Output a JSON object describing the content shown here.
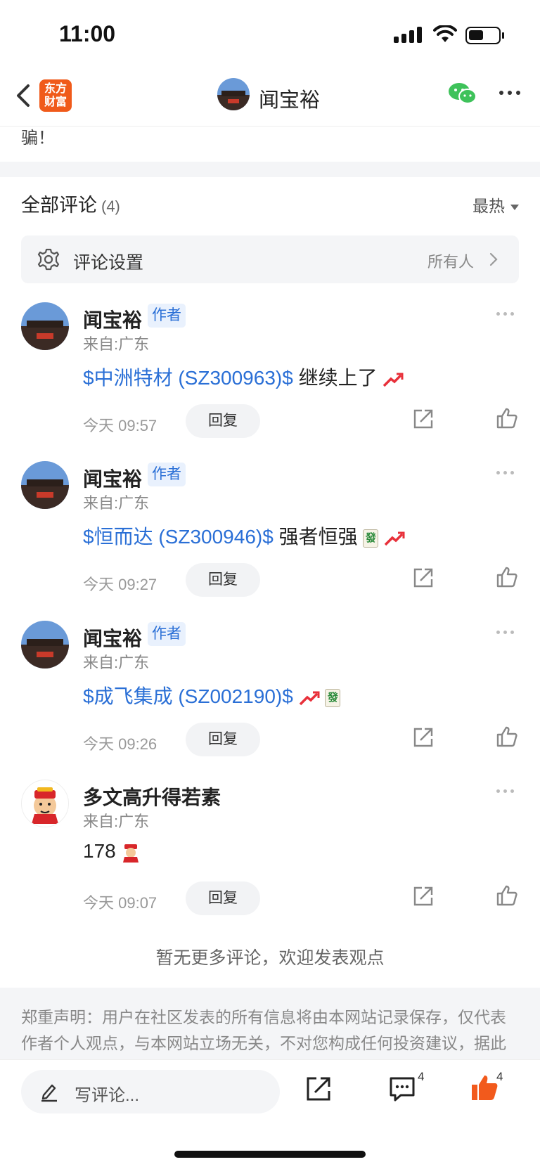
{
  "status_bar": {
    "time": "11:00"
  },
  "nav": {
    "brand_logo_text": "东方\n财富",
    "user_name": "闻宝裕"
  },
  "article_tail": "骗！",
  "comments_section": {
    "title": "全部评论",
    "count": "(4)",
    "sort_label": "最热",
    "settings_label": "评论设置",
    "settings_value": "所有人"
  },
  "comments": [
    {
      "user": "闻宝裕",
      "tag": "作者",
      "location": "来自:广东",
      "stock": "$中洲特材 (SZ300963)$",
      "text": " 继续上了",
      "extras": [
        "trend-up"
      ],
      "time": "今天 09:57",
      "reply_label": "回复"
    },
    {
      "user": "闻宝裕",
      "tag": "作者",
      "location": "来自:广东",
      "stock": "$恒而达 (SZ300946)$",
      "text": " 强者恒强",
      "extras": [
        "mahjong-fa",
        "trend-up"
      ],
      "time": "今天 09:27",
      "reply_label": "回复"
    },
    {
      "user": "闻宝裕",
      "tag": "作者",
      "location": "来自:广东",
      "stock": "$成飞集成 (SZ002190)$",
      "text": " ",
      "extras": [
        "trend-up",
        "mahjong-fa"
      ],
      "time": "今天 09:26",
      "reply_label": "回复"
    },
    {
      "user": "多文高升得若素",
      "tag": "",
      "location": "来自:广东",
      "stock": "",
      "text": "178",
      "extras": [
        "fortune-god"
      ],
      "time": "今天 09:07",
      "reply_label": "回复"
    }
  ],
  "no_more_text": "暂无更多评论，欢迎发表观点",
  "disclaimer": "郑重声明：用户在社区发表的所有信息将由本网站记录保存，仅代表作者个人观点，与本网站立场无关，不对您构成任何投资建议，据此操作风险自担。",
  "bottom_bar": {
    "input_placeholder": "写评论...",
    "comment_count": "4",
    "like_count": "4"
  },
  "colors": {
    "accent_blue": "#2a6fd6",
    "brand_orange": "#f05a1a",
    "like_orange": "#f25a1c"
  }
}
